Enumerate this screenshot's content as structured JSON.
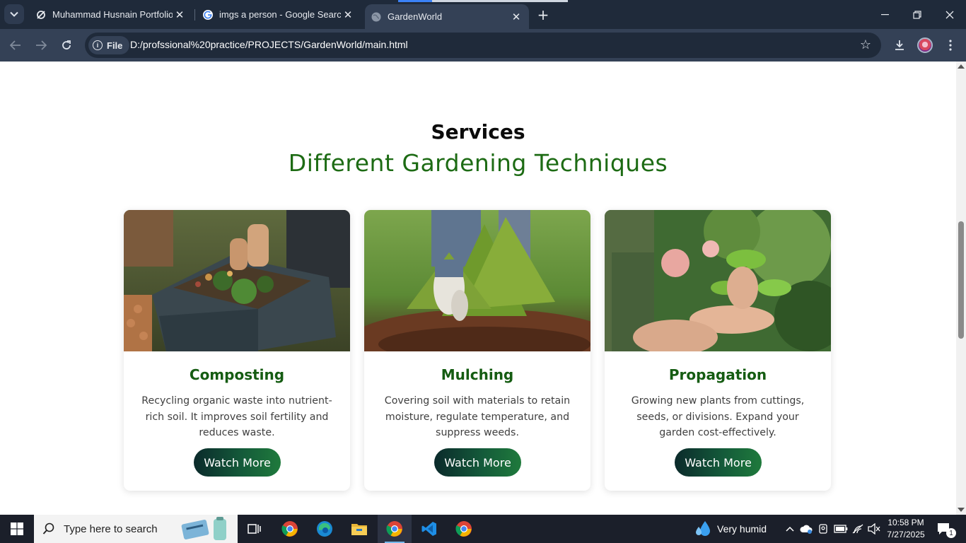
{
  "browser": {
    "tabs": [
      {
        "title": "Muhammad Husnain Portfolio D",
        "active": false
      },
      {
        "title": "imgs a person - Google Search",
        "active": false
      },
      {
        "title": "GardenWorld",
        "active": true
      }
    ],
    "new_tab": "+",
    "address": {
      "scheme_chip": "File",
      "url": "D:/profssional%20practice/PROJECTS/GardenWorld/main.html"
    }
  },
  "page": {
    "section_title": "Services",
    "section_subtitle": "Different Gardening Techniques",
    "cards": [
      {
        "title": "Composting",
        "description": "Recycling organic waste into nutrient-rich soil. It improves soil fertility and reduces waste.",
        "button": "Watch More",
        "image": "compost-bin-photo"
      },
      {
        "title": "Mulching",
        "description": "Covering soil with materials to retain moisture, regulate temperature, and suppress weeds.",
        "button": "Watch More",
        "image": "mulching-plant-photo"
      },
      {
        "title": "Propagation",
        "description": "Growing new plants from cuttings, seeds, or divisions. Expand your garden cost-effectively.",
        "button": "Watch More",
        "image": "propagation-seedling-photo"
      }
    ]
  },
  "taskbar": {
    "search_placeholder": "Type here to search",
    "weather": "Very humid",
    "time": "10:58 PM",
    "date": "7/27/2025",
    "notification_count": "1"
  },
  "colors": {
    "accent_green": "#1d6b14",
    "card_title_green": "#155c12",
    "chrome_dark": "#1f2a3a",
    "chrome_toolbar": "#344156"
  }
}
